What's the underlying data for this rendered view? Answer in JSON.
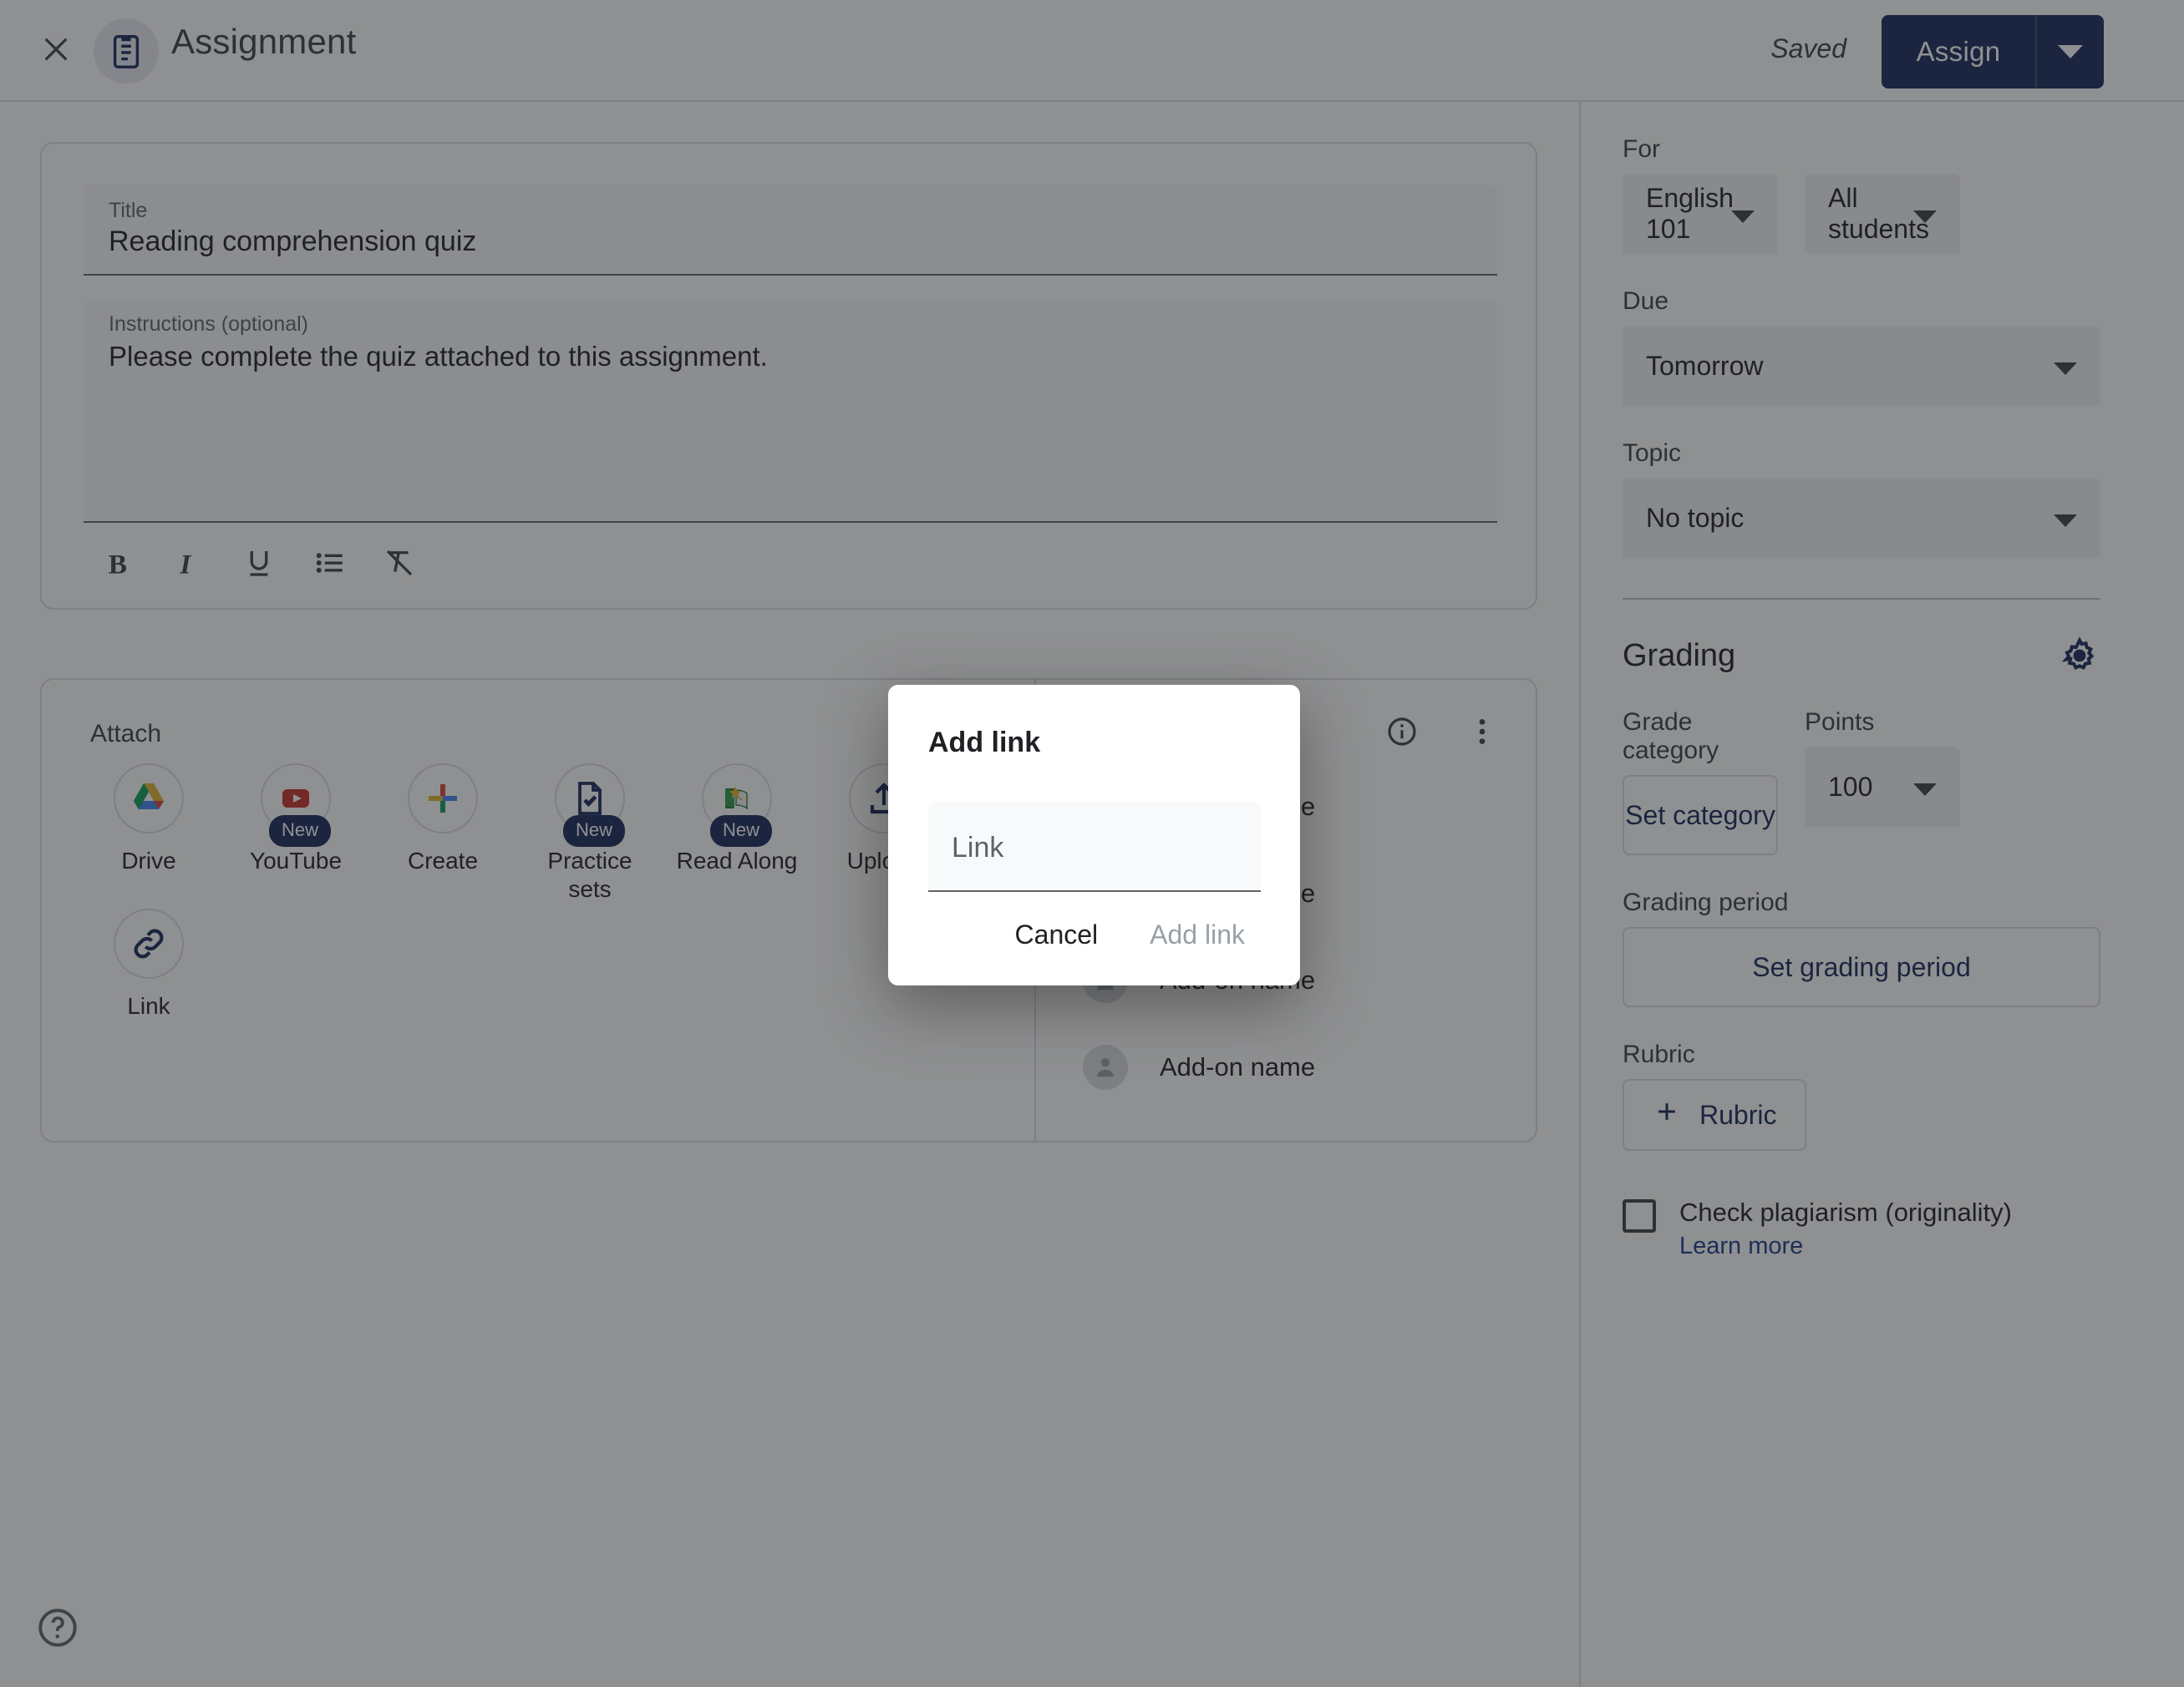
{
  "header": {
    "close_icon": "close-icon",
    "doc_icon": "assignment-clipboard-icon",
    "title": "Assignment",
    "saved_status": "Saved",
    "assign_label": "Assign",
    "assign_caret_icon": "chevron-down-icon",
    "accent_color": "#17295c"
  },
  "details": {
    "title_label": "Title",
    "title_value": "Reading comprehension quiz",
    "instructions_label": "Instructions (optional)",
    "instructions_value": "Please complete the quiz attached to this assignment.",
    "format_buttons": [
      {
        "name": "bold-icon",
        "label": "B"
      },
      {
        "name": "italic-icon",
        "label": "I"
      },
      {
        "name": "underline-icon",
        "label": "U"
      },
      {
        "name": "bulleted-list-icon",
        "label": "List"
      },
      {
        "name": "clear-formatting-icon",
        "label": "Clear formatting"
      }
    ]
  },
  "attach": {
    "section_label": "Attach",
    "items": [
      {
        "label": "Drive",
        "icon": "google-drive-icon",
        "badge": ""
      },
      {
        "label": "YouTube",
        "icon": "youtube-icon",
        "badge": "New"
      },
      {
        "label": "Create",
        "icon": "create-plus-icon",
        "badge": ""
      },
      {
        "label": "Practice sets",
        "icon": "practice-sets-icon",
        "badge": "New"
      },
      {
        "label": "Read Along",
        "icon": "read-along-icon",
        "badge": "New"
      },
      {
        "label": "Upload",
        "icon": "upload-icon",
        "badge": ""
      },
      {
        "label": "Link",
        "icon": "link-icon",
        "badge": ""
      }
    ],
    "info_icon": "info-icon",
    "more_icon": "more-vert-icon",
    "addons": [
      {
        "label": "Add-on name"
      },
      {
        "label": "Add-on name"
      },
      {
        "label": "Add-on name"
      },
      {
        "label": "Add-on name"
      }
    ]
  },
  "sidebar": {
    "for_label": "For",
    "class_value": "English 101",
    "students_value": "All students",
    "due_label": "Due",
    "due_value": "Tomorrow",
    "topic_label": "Topic",
    "topic_value": "No topic",
    "grading_title": "Grading",
    "grading_settings_icon": "gear-icon",
    "grade_category_label": "Grade category",
    "set_category_label": "Set category",
    "points_label": "Points",
    "points_value": "100",
    "grading_period_label": "Grading period",
    "set_grading_period_label": "Set grading period",
    "rubric_label": "Rubric",
    "rubric_button_label": "Rubric",
    "plagiarism_label": "Check plagiarism (originality)",
    "learn_more_label": "Learn more",
    "link_color": "#1a3a8f"
  },
  "dialog": {
    "title": "Add link",
    "field_placeholder": "Link",
    "field_value": "",
    "cancel_label": "Cancel",
    "confirm_label": "Add link"
  },
  "help": {
    "icon": "help-circle-icon"
  }
}
